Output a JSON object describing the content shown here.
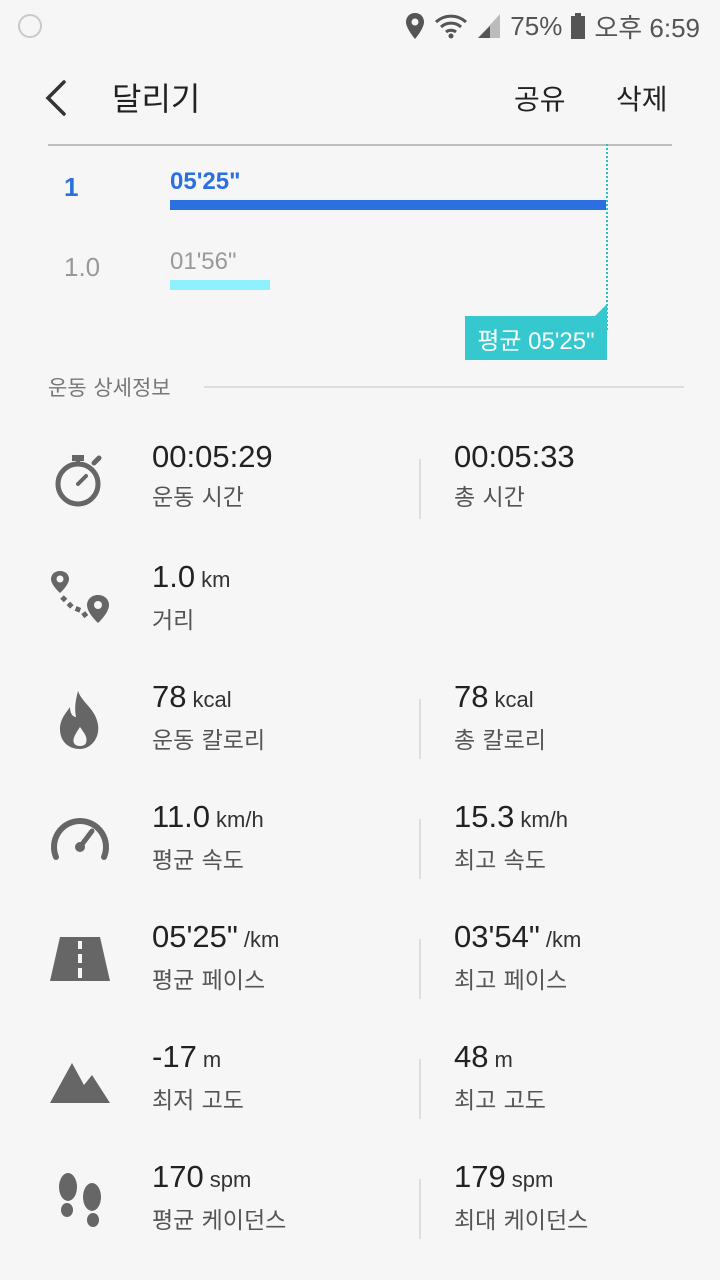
{
  "status_bar": {
    "battery": "75%",
    "time": "오후 6:59"
  },
  "app_bar": {
    "title": "달리기",
    "share": "공유",
    "delete": "삭제"
  },
  "laps": [
    {
      "label": "1",
      "time": "05'25\"",
      "value_seconds": 325,
      "color": "#2b6fe0",
      "highlight": true
    },
    {
      "label": "1.0",
      "time": "01'56\"",
      "value_seconds": 116,
      "color": "#8ff1ff",
      "highlight": false
    }
  ],
  "average_tag": "평균 05'25\"",
  "section_title": "운동 상세정보",
  "stats": [
    {
      "icon": "stopwatch-icon",
      "left": {
        "value": "00:05:29",
        "unit": "",
        "label": "운동 시간"
      },
      "right": {
        "value": "00:05:33",
        "unit": "",
        "label": "총 시간"
      }
    },
    {
      "icon": "route-icon",
      "left": {
        "value": "1.0",
        "unit": "km",
        "label": "거리"
      },
      "right": null
    },
    {
      "icon": "flame-icon",
      "left": {
        "value": "78",
        "unit": "kcal",
        "label": "운동 칼로리"
      },
      "right": {
        "value": "78",
        "unit": "kcal",
        "label": "총 칼로리"
      }
    },
    {
      "icon": "speedometer-icon",
      "left": {
        "value": "11.0",
        "unit": "km/h",
        "label": "평균 속도"
      },
      "right": {
        "value": "15.3",
        "unit": "km/h",
        "label": "최고 속도"
      }
    },
    {
      "icon": "road-icon",
      "left": {
        "value": "05'25\"",
        "unit": "/km",
        "label": "평균 페이스"
      },
      "right": {
        "value": "03'54\"",
        "unit": "/km",
        "label": "최고 페이스"
      }
    },
    {
      "icon": "mountain-icon",
      "left": {
        "value": "-17",
        "unit": "m",
        "label": "최저 고도"
      },
      "right": {
        "value": "48",
        "unit": "m",
        "label": "최고 고도"
      }
    },
    {
      "icon": "footprints-icon",
      "left": {
        "value": "170",
        "unit": "spm",
        "label": "평균 케이던스"
      },
      "right": {
        "value": "179",
        "unit": "spm",
        "label": "최대 케이던스"
      }
    }
  ]
}
